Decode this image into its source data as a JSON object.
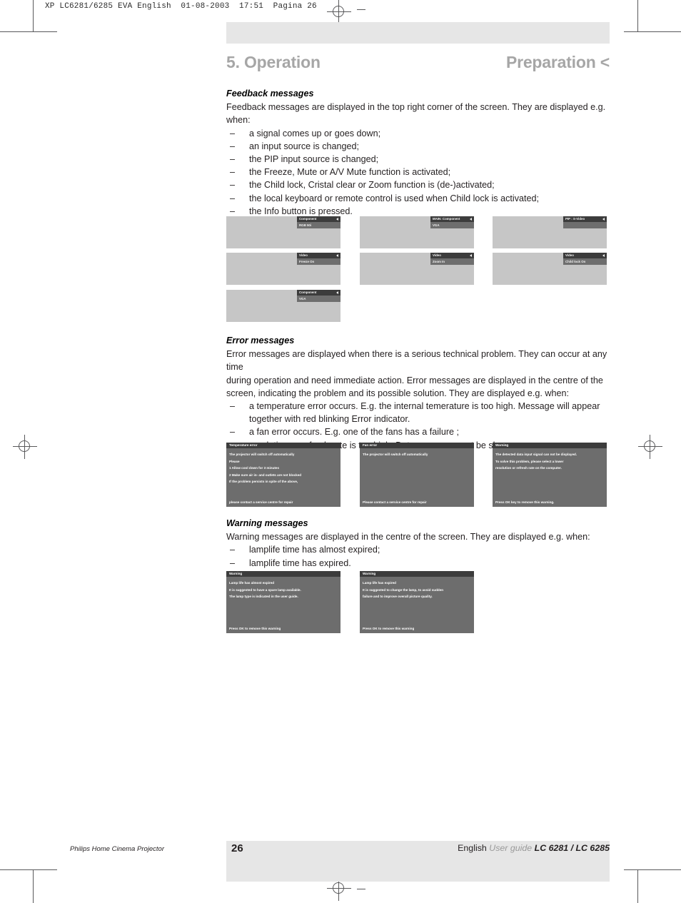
{
  "slug": "XP LC6281/6285 EVA English  01-08-2003  17:51  Pagina 26",
  "header": {
    "chapter": "5. Operation",
    "section": "Preparation <"
  },
  "feedback": {
    "heading": "Feedback messages",
    "intro_line1": "Feedback messages are displayed in the top right corner of the screen. They are displayed e.g.",
    "intro_line2": "when:",
    "items": [
      "a signal comes up or goes down;",
      "an input source is changed;",
      "the PIP input source is changed;",
      "the Freeze, Mute or A/V Mute function is activated;",
      "the Child lock, Cristal clear or Zoom function is (de-)activated;",
      "the local keyboard or remote control is used when Child lock is activated;",
      "the Info button is pressed."
    ],
    "shots": [
      {
        "name": "signal-change",
        "title": "Component",
        "value": "RGB 50i"
      },
      {
        "name": "main-input-change",
        "title": "MAIN: Component",
        "value": "VGA"
      },
      {
        "name": "pip-input-change",
        "title": "PIP : S-Video",
        "value": ""
      },
      {
        "name": "freeze-on",
        "title": "Video",
        "value": "Freeze On"
      },
      {
        "name": "zoom-in",
        "title": "Video",
        "value": "Zoom In"
      },
      {
        "name": "child-lock-on",
        "title": "Video",
        "value": "Child lock On"
      },
      {
        "name": "info-button",
        "title": "Component",
        "value": "VGA"
      }
    ]
  },
  "error": {
    "heading": "Error messages",
    "paragraph": [
      "Error messages are displayed when there is a serious technical problem. They can occur at any time",
      "during operation and need immediate action. Error messages are displayed in the centre of the",
      "screen, indicating the problem and its possible solution. They are displayed e.g. when:"
    ],
    "items": [
      "a temperature error occurs. E.g. the internal temerature is too high. Message will appear",
      "together with red blinking Error indicator.",
      "a fan error occurs. E.g. one of the fans has a failure ;",
      "resolution or refresh rate is too high. Data source cannot be shown."
    ],
    "boxes": [
      {
        "name": "temperature-error",
        "title": "Temperature error",
        "lines": [
          "The projector will switch off automatically",
          "Please",
          "1 Allow cool down for 3 minutes",
          "2 Make sure air in- and outlets are not blocked",
          "If the problem persists in spite of the above,"
        ],
        "footer": "please contact a service centre for repair"
      },
      {
        "name": "fan-error",
        "title": "Fan error",
        "lines": [
          "The projector will switch off automatically"
        ],
        "footer": "Please contact a service centre for repair"
      },
      {
        "name": "resolution-warning",
        "title": "Warning",
        "lines": [
          "The detected data input signal can not be displayed.",
          "To solve this problem, please select a lower",
          "resolution or refresh rate on the computer."
        ],
        "footer": "Press OK key to remove this warning."
      }
    ]
  },
  "warning": {
    "heading": "Warning messages",
    "paragraph": "Warning messages are displayed in the centre of the screen. They are displayed e.g. when:",
    "items": [
      "lamplife time has almost expired;",
      "lamplife time has expired."
    ],
    "boxes": [
      {
        "name": "lamp-almost-expired",
        "title": "Warning",
        "lines": [
          "Lamp life has almost expired",
          "It is suggested to have a spare lamp available.",
          "The lamp type is indicated in the user guide."
        ],
        "footer": "Press OK to remove this warning"
      },
      {
        "name": "lamp-expired",
        "title": "Warning",
        "lines": [
          "Lamp life has expired",
          "It is suggested to change the lamp, to avoid sudden",
          "failure and to improve overall picture quality."
        ],
        "footer": "Press OK to remove this warning"
      }
    ]
  },
  "footer": {
    "brand": "Philips Home Cinema Projector",
    "page_number": "26",
    "language": "English",
    "guide": "User guide",
    "model": "LC 6281 / LC 6285"
  }
}
